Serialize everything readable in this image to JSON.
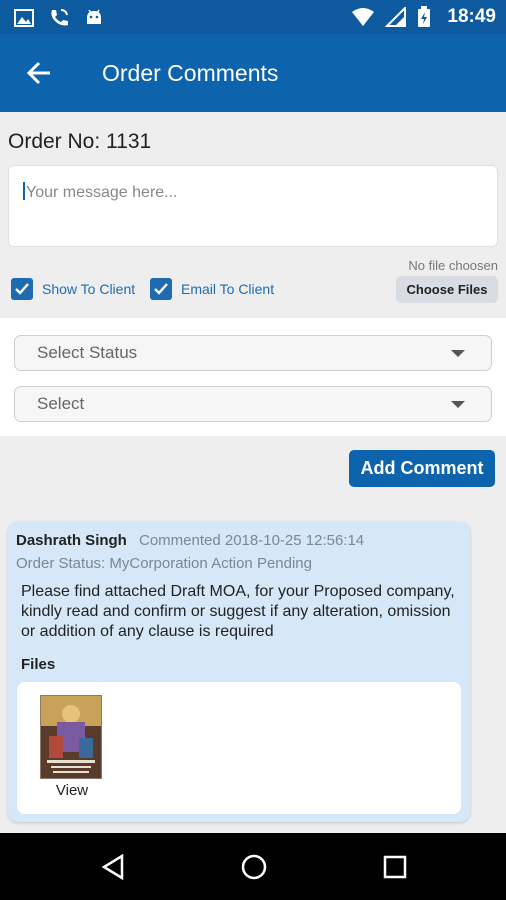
{
  "status_bar": {
    "time": "18:49",
    "icons_left": [
      "image-icon",
      "phone-icon",
      "android-icon"
    ],
    "icons_right": [
      "wifi-icon",
      "signal-icon",
      "battery-icon"
    ]
  },
  "app_bar": {
    "title": "Order Comments",
    "back_icon": "arrow-left-icon"
  },
  "order": {
    "label": "Order No: 1131"
  },
  "message": {
    "placeholder": "Your message here..."
  },
  "file_picker": {
    "status": "No file choosen",
    "button_label": "Choose Files"
  },
  "options": {
    "show_to_client": {
      "label": "Show To Client",
      "checked": true
    },
    "email_to_client": {
      "label": "Email To Client",
      "checked": true
    }
  },
  "selects": {
    "status": {
      "value": "Select Status"
    },
    "second": {
      "value": "Select"
    }
  },
  "actions": {
    "add_comment": "Add Comment"
  },
  "comment": {
    "author": "Dashrath Singh",
    "meta": "Commented 2018-10-25 12:56:14",
    "order_status": "Order Status: MyCorporation Action Pending",
    "text": "Please find attached Draft MOA, for your Proposed company, kindly read and confirm or suggest if any alteration, omission or addition of any clause is required",
    "files_label": "Files",
    "file_view_label": "View"
  },
  "colors": {
    "status_bar": "#0d5a9e",
    "app_bar": "#0e63ad",
    "accent": "#0e63ad",
    "comment_card": "#d6e7f7"
  }
}
